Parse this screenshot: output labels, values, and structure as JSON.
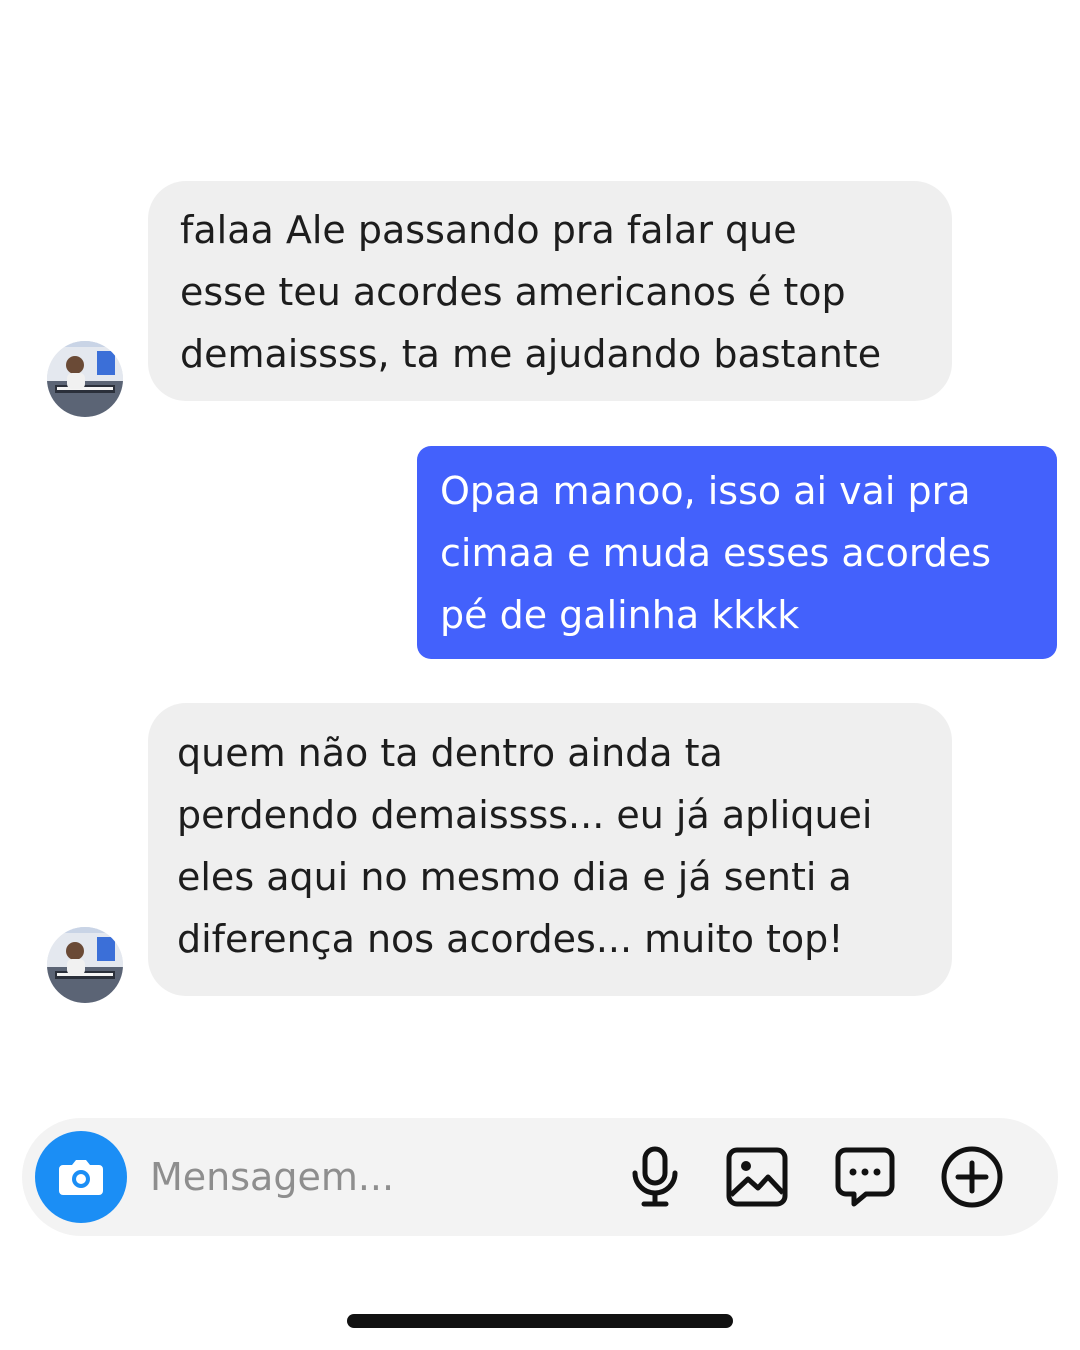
{
  "messages": [
    {
      "direction": "incoming",
      "text": "falaa Ale passando pra falar que\nesse teu acordes americanos é top\ndemaissss, ta me ajudando bastante"
    },
    {
      "direction": "outgoing",
      "text": "Opaa manoo, isso ai vai pra\ncimaa e muda esses acordes\npé de galinha kkkk"
    },
    {
      "direction": "incoming",
      "text": "quem não ta dentro ainda ta\nperdendo demaissss... eu já apliquei\neles aqui no mesmo dia e já senti a\ndiferença nos acordes... muito top!"
    }
  ],
  "composer": {
    "placeholder": "Mensagem..."
  },
  "icons": {
    "camera": "camera-icon",
    "mic": "microphone-icon",
    "gallery": "image-icon",
    "sticker": "message-dots-icon",
    "plus": "plus-circle-icon"
  },
  "colors": {
    "incoming_bubble": "#efefef",
    "outgoing_bubble": "#4361fc",
    "camera_button": "#1b8ef5",
    "composer_bg": "#f3f3f3"
  }
}
